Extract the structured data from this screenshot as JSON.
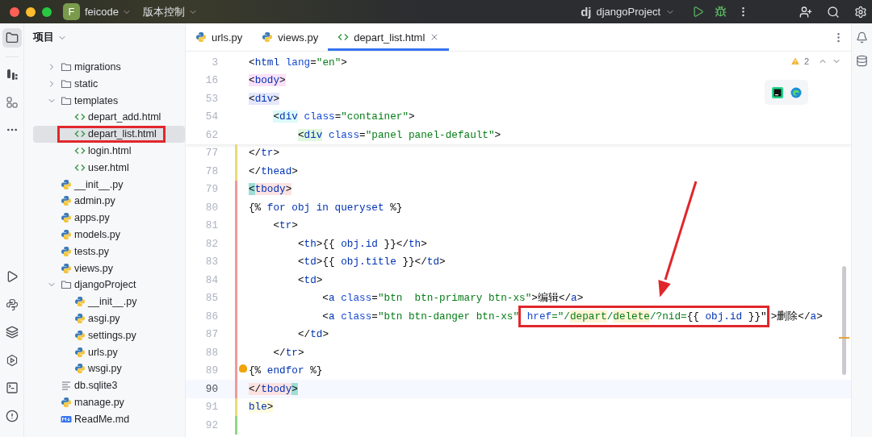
{
  "title_bar": {
    "project_initial": "F",
    "project": "feicode",
    "vcs": "版本控制",
    "run_logo": "dj",
    "run_config": "djangoProject"
  },
  "tool_strip": {
    "top": [
      {
        "selected": true
      },
      {
        "selected": false
      },
      {
        "selected": false
      },
      {
        "selected": false
      }
    ],
    "bottom": [
      {
        "selected": false
      },
      {
        "selected": false
      },
      {
        "selected": false
      },
      {
        "selected": false
      },
      {
        "selected": false
      },
      {
        "selected": false
      }
    ]
  },
  "project_panel": {
    "title": "项目",
    "tree": [
      {
        "children": [
          {
            "label": "migrations",
            "kind": "folder",
            "expanded": false,
            "selected": false,
            "marked": false
          },
          {
            "label": "static",
            "kind": "folder",
            "expanded": false,
            "selected": false,
            "marked": false
          },
          {
            "label": "templates",
            "kind": "folder",
            "expanded": true,
            "selected": false,
            "marked": false,
            "children": [
              {
                "label": "depart_add.html",
                "kind": "html",
                "selected": false,
                "marked": false
              },
              {
                "label": "depart_list.html",
                "kind": "html",
                "selected": true,
                "marked": true
              },
              {
                "label": "login.html",
                "kind": "html",
                "selected": false,
                "marked": false
              },
              {
                "label": "user.html",
                "kind": "html",
                "selected": false,
                "marked": false
              }
            ]
          },
          {
            "label": "__init__.py",
            "kind": "python",
            "selected": false,
            "marked": false
          },
          {
            "label": "admin.py",
            "kind": "python",
            "selected": false,
            "marked": false
          },
          {
            "label": "apps.py",
            "kind": "python",
            "selected": false,
            "marked": false
          },
          {
            "label": "models.py",
            "kind": "python",
            "selected": false,
            "marked": false
          },
          {
            "label": "tests.py",
            "kind": "python",
            "selected": false,
            "marked": false
          },
          {
            "label": "views.py",
            "kind": "python",
            "selected": false,
            "marked": false
          }
        ]
      },
      {
        "label": "djangoProject",
        "kind": "folder",
        "expanded": true,
        "selected": false,
        "marked": false,
        "children": [
          {
            "label": "__init__.py",
            "kind": "python",
            "selected": false,
            "marked": false
          },
          {
            "label": "asgi.py",
            "kind": "python",
            "selected": false,
            "marked": false
          },
          {
            "label": "settings.py",
            "kind": "python",
            "selected": false,
            "marked": false
          },
          {
            "label": "urls.py",
            "kind": "python",
            "selected": false,
            "marked": false
          },
          {
            "label": "wsgi.py",
            "kind": "python",
            "selected": false,
            "marked": false
          }
        ]
      },
      {
        "label": "db.sqlite3",
        "kind": "text",
        "selected": false,
        "marked": false
      },
      {
        "label": "manage.py",
        "kind": "python",
        "selected": false,
        "marked": false
      },
      {
        "label": "ReadMe.md",
        "kind": "markdown",
        "selected": false,
        "marked": false
      }
    ]
  },
  "editor": {
    "tabs": [
      {
        "label": "urls.py",
        "kind": "python",
        "selected": false
      },
      {
        "label": "views.py",
        "kind": "python",
        "selected": false
      },
      {
        "label": "depart_list.html",
        "kind": "html",
        "selected": true
      }
    ],
    "inspection": {
      "warnings": "2"
    },
    "sticky_lines": [
      {
        "number": "3",
        "segments": [
          {
            "text": "<",
            "kind": "plain"
          },
          {
            "text": "html",
            "kind": "tag"
          },
          {
            "text": " lang",
            "kind": "attribute"
          },
          {
            "text": "=",
            "kind": "plain"
          },
          {
            "text": "\"en\"",
            "kind": "string"
          },
          {
            "text": ">",
            "kind": "plain"
          }
        ]
      },
      {
        "number": "16",
        "segments": [
          {
            "text": "<",
            "kind": "plain",
            "color": "#fbe0f8"
          },
          {
            "text": "body",
            "kind": "tag",
            "color": "#fbe0f8"
          },
          {
            "text": ">",
            "kind": "plain",
            "color": "#fbe0f8"
          }
        ]
      },
      {
        "number": "53",
        "segments": [
          {
            "text": "<",
            "kind": "plain",
            "color": "#e5e7fb"
          },
          {
            "text": "div",
            "kind": "tag",
            "color": "#e5e7fb"
          },
          {
            "text": ">",
            "kind": "plain",
            "color": "#e5e7fb"
          }
        ]
      },
      {
        "number": "54",
        "segments": [
          {
            "text": "    <",
            "kind": "plain",
            "color": "#dcfafa"
          },
          {
            "text": "div",
            "kind": "tag",
            "color": "#dcfafa"
          },
          {
            "text": " class",
            "kind": "attribute"
          },
          {
            "text": "=",
            "kind": "plain"
          },
          {
            "text": "\"container\"",
            "kind": "string"
          },
          {
            "text": ">",
            "kind": "plain"
          }
        ]
      },
      {
        "number": "62",
        "segments": [
          {
            "text": "        <",
            "kind": "plain",
            "color": "#e0f6df"
          },
          {
            "text": "div",
            "kind": "tag",
            "color": "#e0f6df"
          },
          {
            "text": " class",
            "kind": "attribute"
          },
          {
            "text": "=",
            "kind": "plain"
          },
          {
            "text": "\"panel panel-default\"",
            "kind": "string"
          },
          {
            "text": ">",
            "kind": "plain"
          }
        ]
      }
    ],
    "lines": [
      {
        "number": "77",
        "color": "#e6dc7a",
        "current": false,
        "bulb": false,
        "segments": [
          {
            "text": "</",
            "kind": "plain"
          },
          {
            "text": "tr",
            "kind": "tag"
          },
          {
            "text": ">",
            "kind": "plain"
          }
        ]
      },
      {
        "number": "78",
        "color": "#e6dc7a",
        "current": false,
        "bulb": false,
        "segments": [
          {
            "text": "</",
            "kind": "plain"
          },
          {
            "text": "thead",
            "kind": "tag"
          },
          {
            "text": ">",
            "kind": "plain"
          }
        ]
      },
      {
        "number": "79",
        "color": "#ef9a9a",
        "current": false,
        "bulb": false,
        "segments": [
          {
            "text": "<",
            "kind": "plain",
            "color": "#9fded7"
          },
          {
            "text": "tbody",
            "kind": "tag",
            "color": "#fde2e2"
          },
          {
            "text": ">",
            "kind": "plain",
            "color": "#fde2e2"
          }
        ]
      },
      {
        "number": "80",
        "color": "#ef9a9a",
        "current": false,
        "bulb": false,
        "segments": [
          {
            "text": "{% ",
            "kind": "plain"
          },
          {
            "text": "for obj in queryset",
            "kind": "template"
          },
          {
            "text": " %}",
            "kind": "plain"
          }
        ]
      },
      {
        "number": "81",
        "color": "#ef9a9a",
        "current": false,
        "bulb": false,
        "segments": [
          {
            "text": "    <",
            "kind": "plain"
          },
          {
            "text": "tr",
            "kind": "tag"
          },
          {
            "text": ">",
            "kind": "plain"
          }
        ]
      },
      {
        "number": "82",
        "color": "#ef9a9a",
        "current": false,
        "bulb": false,
        "segments": [
          {
            "text": "        <",
            "kind": "plain"
          },
          {
            "text": "th",
            "kind": "tag"
          },
          {
            "text": ">{{ ",
            "kind": "plain"
          },
          {
            "text": "obj.id",
            "kind": "template"
          },
          {
            "text": " }}</",
            "kind": "plain"
          },
          {
            "text": "th",
            "kind": "tag"
          },
          {
            "text": ">",
            "kind": "plain"
          }
        ]
      },
      {
        "number": "83",
        "color": "#ef9a9a",
        "current": false,
        "bulb": false,
        "segments": [
          {
            "text": "        <",
            "kind": "plain"
          },
          {
            "text": "td",
            "kind": "tag"
          },
          {
            "text": ">{{ ",
            "kind": "plain"
          },
          {
            "text": "obj.title",
            "kind": "template"
          },
          {
            "text": " }}</",
            "kind": "plain"
          },
          {
            "text": "td",
            "kind": "tag"
          },
          {
            "text": ">",
            "kind": "plain"
          }
        ]
      },
      {
        "number": "84",
        "color": "#ef9a9a",
        "current": false,
        "bulb": false,
        "segments": [
          {
            "text": "        <",
            "kind": "plain"
          },
          {
            "text": "td",
            "kind": "tag"
          },
          {
            "text": ">",
            "kind": "plain"
          }
        ]
      },
      {
        "number": "85",
        "color": "#ef9a9a",
        "current": false,
        "bulb": false,
        "segments": [
          {
            "text": "            <",
            "kind": "plain"
          },
          {
            "text": "a",
            "kind": "tag"
          },
          {
            "text": " class",
            "kind": "attribute"
          },
          {
            "text": "=",
            "kind": "plain"
          },
          {
            "text": "\"btn  btn-primary btn-xs\"",
            "kind": "string"
          },
          {
            "text": ">编辑</",
            "kind": "plain"
          },
          {
            "text": "a",
            "kind": "tag"
          },
          {
            "text": ">",
            "kind": "plain"
          }
        ]
      },
      {
        "number": "86",
        "color": "#ef9a9a",
        "current": false,
        "bulb": false,
        "segments": [
          {
            "text": "            <",
            "kind": "plain"
          },
          {
            "text": "a",
            "kind": "tag"
          },
          {
            "text": " class",
            "kind": "attribute"
          },
          {
            "text": "=",
            "kind": "plain"
          },
          {
            "text": "\"btn btn-danger btn-xs\"",
            "kind": "string"
          },
          {
            "kind": "annotation-box",
            "segments": [
              {
                "text": " href",
                "kind": "attribute"
              },
              {
                "text": "=\"/",
                "kind": "string"
              },
              {
                "text": "depart",
                "kind": "string",
                "color": "#fdf4d6"
              },
              {
                "text": "/",
                "kind": "string"
              },
              {
                "text": "delete",
                "kind": "string",
                "color": "#fdf4d6"
              },
              {
                "text": "/?nid=",
                "kind": "string"
              },
              {
                "text": "{{ ",
                "kind": "plain"
              },
              {
                "text": "obj.id",
                "kind": "template"
              },
              {
                "text": " }}\"",
                "kind": "plain"
              }
            ]
          },
          {
            "text": ">删除</",
            "kind": "plain"
          },
          {
            "text": "a",
            "kind": "tag"
          },
          {
            "text": ">",
            "kind": "plain"
          }
        ]
      },
      {
        "number": "87",
        "color": "#ef9a9a",
        "current": false,
        "bulb": false,
        "segments": [
          {
            "text": "        </",
            "kind": "plain"
          },
          {
            "text": "td",
            "kind": "tag"
          },
          {
            "text": ">",
            "kind": "plain"
          }
        ]
      },
      {
        "number": "88",
        "color": "#ef9a9a",
        "current": false,
        "bulb": false,
        "segments": [
          {
            "text": "    </",
            "kind": "plain"
          },
          {
            "text": "tr",
            "kind": "tag"
          },
          {
            "text": ">",
            "kind": "plain"
          }
        ]
      },
      {
        "number": "89",
        "color": "#ef9a9a",
        "current": false,
        "bulb": true,
        "segments": [
          {
            "text": "{% ",
            "kind": "plain"
          },
          {
            "text": "endfor",
            "kind": "template"
          },
          {
            "text": " %}",
            "kind": "plain"
          }
        ]
      },
      {
        "number": "90",
        "color": "#ef9a9a",
        "current": true,
        "bulb": false,
        "segments": [
          {
            "text": "</",
            "kind": "plain",
            "color": "#fde2e2"
          },
          {
            "text": "tbody",
            "kind": "tag",
            "color": "#fde2e2"
          },
          {
            "text": ">",
            "kind": "plain",
            "color": "#9fded7"
          }
        ]
      },
      {
        "number": "91",
        "color": "#e6dc7a",
        "current": false,
        "bulb": false,
        "segments": [
          {
            "text": "ble",
            "kind": "tag",
            "color": "#fffbe0"
          },
          {
            "text": ">",
            "kind": "plain",
            "color": "#fffbe0"
          }
        ]
      },
      {
        "number": "92",
        "color": "#93d48a",
        "current": false,
        "bulb": false
      }
    ],
    "annotations": [
      {
        "kind": "arrow"
      }
    ]
  }
}
